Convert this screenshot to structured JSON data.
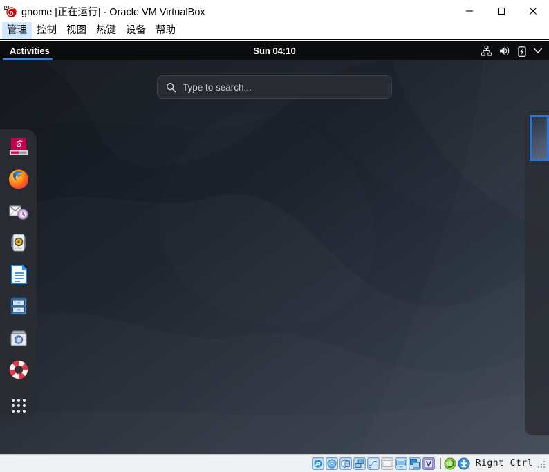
{
  "window": {
    "title": "gnome [正在运行] - Oracle VM VirtualBox",
    "app_icon": "virtualbox-icon",
    "buttons": [
      {
        "name": "minimize-button",
        "label": "—",
        "icon": "minimize-icon"
      },
      {
        "name": "maximize-button",
        "label": "□",
        "icon": "maximize-icon"
      },
      {
        "name": "close-button",
        "label": "✕",
        "icon": "close-icon"
      }
    ]
  },
  "menubar": {
    "items": [
      {
        "label": "管理",
        "active": true
      },
      {
        "label": "控制",
        "active": false
      },
      {
        "label": "视图",
        "active": false
      },
      {
        "label": "热键",
        "active": false
      },
      {
        "label": "设备",
        "active": false
      },
      {
        "label": "帮助",
        "active": false
      }
    ]
  },
  "guest": {
    "topbar": {
      "activities_label": "Activities",
      "clock": "Sun 04:10",
      "tray_icons": [
        {
          "name": "network-wired-icon",
          "label": "network"
        },
        {
          "name": "volume-icon",
          "label": "volume"
        },
        {
          "name": "battery-charging-icon",
          "label": "battery"
        },
        {
          "name": "chevron-down-icon",
          "label": "system menu"
        }
      ]
    },
    "search": {
      "placeholder": "Type to search...",
      "value": "",
      "icon": "search-icon"
    },
    "dock": {
      "items": [
        {
          "name": "dock-item-debian-installer",
          "label": "Install Debian",
          "icon": "debian-installer-icon"
        },
        {
          "name": "dock-item-firefox",
          "label": "Firefox ESR",
          "icon": "firefox-icon"
        },
        {
          "name": "dock-item-evolution",
          "label": "Evolution Mail",
          "icon": "evolution-mail-icon"
        },
        {
          "name": "dock-item-rhythmbox",
          "label": "Rhythmbox",
          "icon": "rhythmbox-icon"
        },
        {
          "name": "dock-item-writer",
          "label": "LibreOffice Writer",
          "icon": "writer-document-icon"
        },
        {
          "name": "dock-item-files",
          "label": "Files",
          "icon": "file-cabinet-icon"
        },
        {
          "name": "dock-item-software",
          "label": "Software",
          "icon": "software-store-icon"
        },
        {
          "name": "dock-item-help",
          "label": "Help",
          "icon": "lifebuoy-icon"
        },
        {
          "name": "dock-item-show-apps",
          "label": "Show Applications",
          "icon": "app-grid-icon"
        }
      ]
    },
    "workspaces": {
      "thumbnails": [
        {
          "name": "workspace-thumbnail-1",
          "active": true
        }
      ]
    },
    "wallpaper_colors": {
      "top_left": "#14171d",
      "bottom_right": "#39414d",
      "accent": "#2a323e"
    }
  },
  "statusbar": {
    "host_key": "Right Ctrl",
    "icons": [
      {
        "name": "status-hard-disk-icon",
        "label": "hard disks"
      },
      {
        "name": "status-optical-drive-icon",
        "label": "optical drives"
      },
      {
        "name": "status-floppy-icon",
        "label": "floppy drives"
      },
      {
        "name": "status-network-icon",
        "label": "network adapters"
      },
      {
        "name": "status-usb-icon",
        "label": "USB devices"
      },
      {
        "name": "status-shared-folders-icon",
        "label": "shared folders"
      },
      {
        "name": "status-display-icon",
        "label": "display"
      },
      {
        "name": "status-recording-icon",
        "label": "recording"
      },
      {
        "name": "status-virtualization-icon",
        "label": "virtualization"
      },
      {
        "name": "status-mouse-capture-icon",
        "label": "mouse integration"
      },
      {
        "name": "status-keyboard-icon",
        "label": "keyboard"
      }
    ]
  },
  "colors": {
    "accent_blue": "#3584e4",
    "menu_highlight": "#cde8ff",
    "topbar_bg": "#0b0c0e",
    "dock_bg": "#2a2d33",
    "statusbar_bg": "#eef0f2"
  }
}
